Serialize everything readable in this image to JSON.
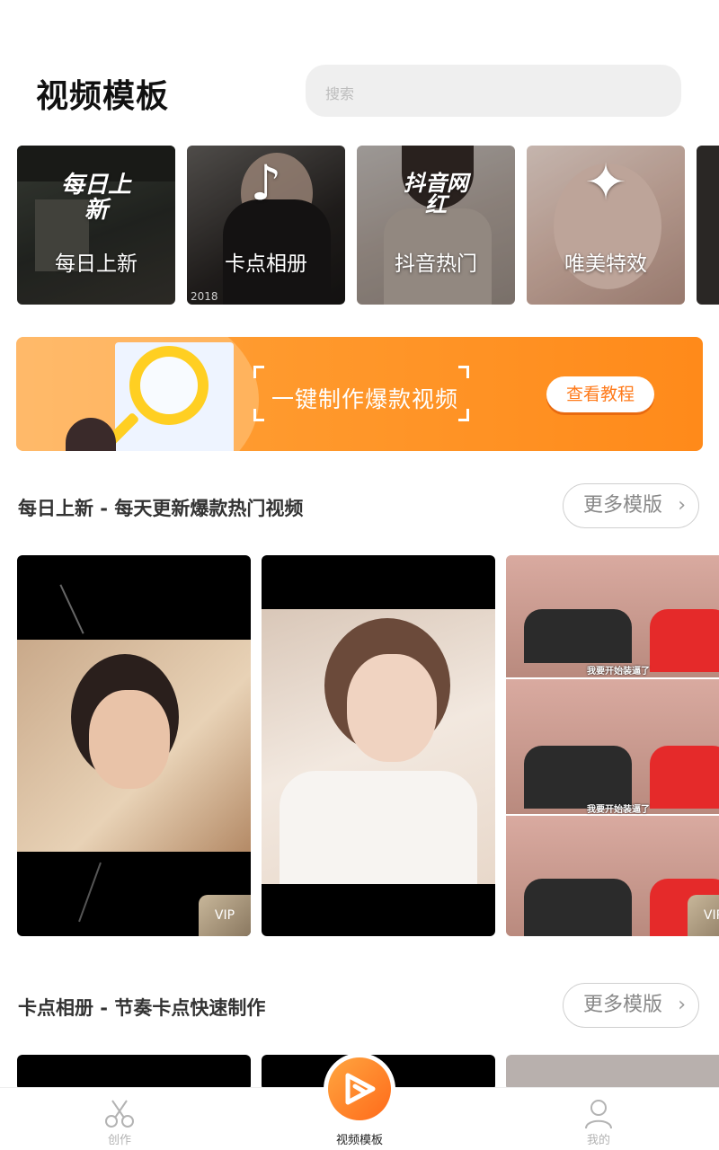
{
  "header": {
    "title": "视频模板",
    "search_placeholder": "搜索"
  },
  "categories": [
    {
      "label": "每日上新",
      "glyph": "每日上新",
      "stamp": ""
    },
    {
      "label": "卡点相册",
      "glyph": "♪",
      "stamp": "2018"
    },
    {
      "label": "抖音热门",
      "glyph": "抖音网红",
      "stamp": ""
    },
    {
      "label": "唯美特效",
      "glyph": "✦",
      "stamp": ""
    }
  ],
  "banner": {
    "slogan": "一键制作爆款视频",
    "button_label": "查看教程"
  },
  "sections": [
    {
      "title": "每日上新 - 每天更新爆款热门视频",
      "more_label": "更多模版",
      "items": [
        {
          "badge": "VIP"
        },
        {
          "badge": ""
        },
        {
          "badge": "VIP",
          "caption": "我要开始装逼了"
        }
      ]
    },
    {
      "title": "卡点相册 - 节奏卡点快速制作",
      "more_label": "更多模版"
    }
  ],
  "tabbar": {
    "tabs": [
      {
        "label": "创作",
        "icon": "scissors-icon",
        "active": false
      },
      {
        "label": "视频模板",
        "icon": "video-template-icon",
        "active": true
      },
      {
        "label": "我的",
        "icon": "person-icon",
        "active": false
      }
    ]
  },
  "colors": {
    "accent": "#ff8a1a",
    "vip_gold": "#a89478",
    "search_bg": "#efefef"
  }
}
